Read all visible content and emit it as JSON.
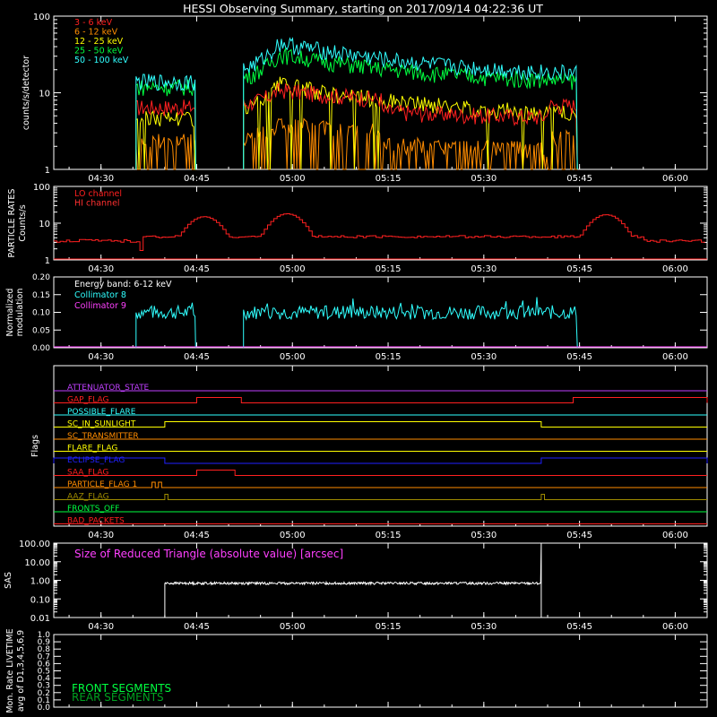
{
  "title": "HESSI Observing Summary, starting on 2017/09/14 04:22:36 UT",
  "time_ticks": [
    "04:30",
    "04:45",
    "05:00",
    "05:15",
    "05:30",
    "05:45",
    "06:00"
  ],
  "chart_data": [
    {
      "type": "line",
      "ylabel": "counts/s/detector",
      "yscale": "log",
      "ylim": [
        1,
        100
      ],
      "yticks": [
        "1",
        "10",
        "100"
      ],
      "x_unit": "UT",
      "data_segments": [
        [
          "04:35:30",
          "04:44:50"
        ],
        [
          "04:52:20",
          "05:44:40"
        ]
      ],
      "series": [
        {
          "name": "3 - 6 keV",
          "color": "#ff2020"
        },
        {
          "name": "6 - 12 keV",
          "color": "#ff8c00"
        },
        {
          "name": "12 - 25 keV",
          "color": "#ffff00"
        },
        {
          "name": "25 - 50 keV",
          "color": "#00ff40"
        },
        {
          "name": "50 - 100 keV",
          "color": "#30ffff"
        }
      ]
    },
    {
      "type": "line",
      "ylabel_1": "PARTICLE RATES",
      "ylabel_2": "Counts/s",
      "yscale": "log",
      "ylim": [
        1,
        100
      ],
      "yticks": [
        "1",
        "10",
        "100"
      ],
      "series": [
        {
          "name": "LO channel",
          "color": "#ff2020"
        },
        {
          "name": "HI channel",
          "color": "#ff3030"
        }
      ],
      "peaks": [
        {
          "t": "04:46",
          "y": 15
        },
        {
          "t": "04:59",
          "y": 18
        },
        {
          "t": "05:49",
          "y": 17
        }
      ],
      "baseline": 4
    },
    {
      "type": "line",
      "ylabel_1": "Normalized",
      "ylabel_2": "modulation",
      "ylim": [
        0,
        0.2
      ],
      "yticks": [
        "0.00",
        "0.05",
        "0.10",
        "0.15",
        "0.20"
      ],
      "annotation": "Energy band: 6-12 keV",
      "series": [
        {
          "name": "Collimator 8",
          "color": "#30ffff",
          "level": 0.1
        },
        {
          "name": "Collimator 9",
          "color": "#ff40ff",
          "level": 0.0
        }
      ]
    },
    {
      "type": "line",
      "ylabel": "Flags",
      "flags": [
        {
          "name": "ATTENUATOR_STATE",
          "color": "#c040ff",
          "high": []
        },
        {
          "name": "GAP_FLAG",
          "color": "#ff2020",
          "high": [
            [
              "04:45",
              "04:52"
            ],
            [
              "05:44",
              "06:05"
            ]
          ]
        },
        {
          "name": "POSSIBLE_FLARE",
          "color": "#30ffff",
          "high": []
        },
        {
          "name": "SC_IN_SUNLIGHT",
          "color": "#ffff00",
          "high": [
            [
              "04:40",
              "05:39"
            ]
          ]
        },
        {
          "name": "SC_TRANSMITTER",
          "color": "#ff8c00",
          "high": []
        },
        {
          "name": "FLARE_FLAG",
          "color": "#ffff00",
          "high": []
        },
        {
          "name": "ECLIPSE_FLAG",
          "color": "#2020ff",
          "high": [
            [
              "04:22",
              "04:40"
            ],
            [
              "05:39",
              "06:05"
            ]
          ]
        },
        {
          "name": "SAA_FLAG",
          "color": "#ff2020",
          "high": [
            [
              "04:45",
              "04:51"
            ]
          ]
        },
        {
          "name": "PARTICLE_FLAG 1",
          "color": "#ff8c00",
          "high": [
            [
              "04:38",
              "04:38:30"
            ],
            [
              "04:39",
              "04:39:30"
            ]
          ]
        },
        {
          "name": "AAZ_FLAG",
          "color": "#a08c00",
          "high": [
            [
              "04:40",
              "04:40:30"
            ],
            [
              "05:39",
              "05:39:30"
            ]
          ]
        },
        {
          "name": "FRONTS_OFF",
          "color": "#00ff40",
          "high": []
        },
        {
          "name": "BAD_PACKETS",
          "color": "#ff2020",
          "high": []
        }
      ]
    },
    {
      "type": "line",
      "ylabel": "SAS",
      "yscale": "log",
      "ylim": [
        0.01,
        100
      ],
      "yticks": [
        "0.01",
        "0.10",
        "1.00",
        "10.00",
        "100.00"
      ],
      "annotation": "Size of Reduced Triangle (absolute value) [arcsec]",
      "data_segments": [
        [
          "04:40",
          "05:39"
        ]
      ],
      "level": 0.7
    },
    {
      "type": "line",
      "ylabel_1": "Mon. Rate LIVETIME",
      "ylabel_2": "avg of D1,3,4,5,6,9",
      "ylim": [
        0,
        1
      ],
      "yticks": [
        "0.0",
        "0.1",
        "0.2",
        "0.3",
        "0.4",
        "0.5",
        "0.6",
        "0.7",
        "0.8",
        "0.9",
        "1.0"
      ],
      "series": [
        {
          "name": "FRONT SEGMENTS",
          "color": "#00ff40"
        },
        {
          "name": "REAR SEGMENTS",
          "color": "#00a020"
        }
      ]
    }
  ]
}
